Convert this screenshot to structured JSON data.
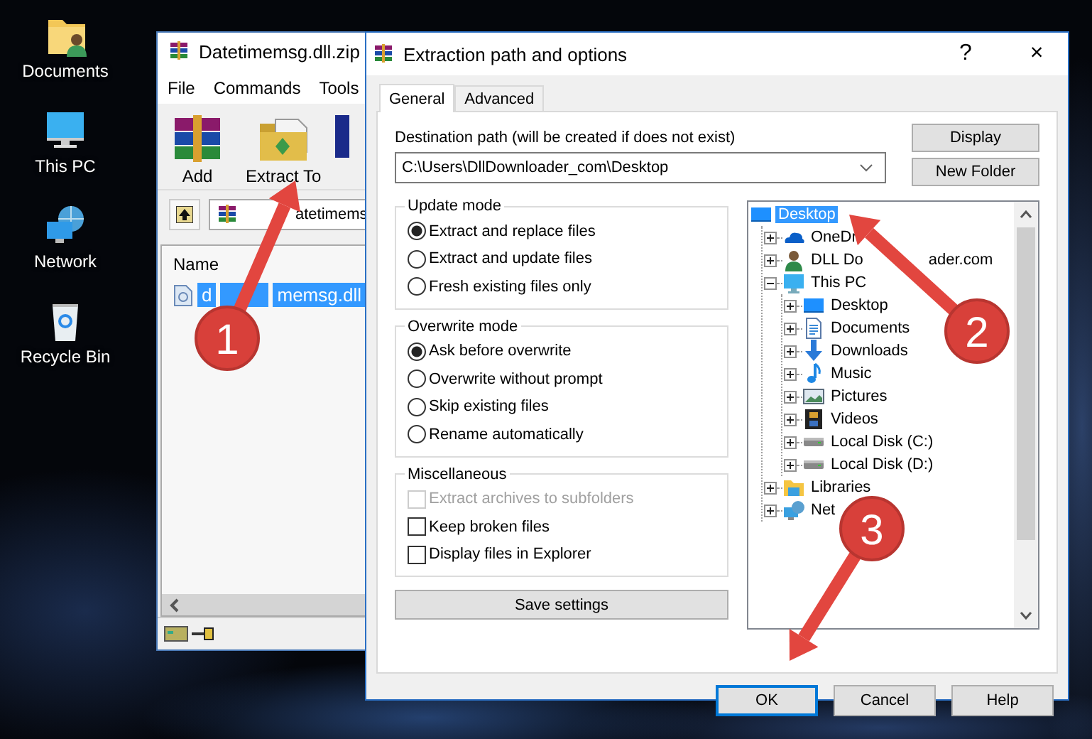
{
  "desktop_icons": [
    {
      "kind": "documents",
      "label": "Documents"
    },
    {
      "kind": "pc",
      "label": "This PC"
    },
    {
      "kind": "network",
      "label": "Network"
    },
    {
      "kind": "recycle",
      "label": "Recycle Bin"
    }
  ],
  "archiver": {
    "title": "Datetimemsg.dll.zip",
    "menu": [
      "File",
      "Commands",
      "Tools"
    ],
    "toolbar": [
      {
        "kind": "add",
        "label": "Add"
      },
      {
        "kind": "extract",
        "label": "Extract To"
      },
      {
        "kind": "book"
      }
    ],
    "path": "atetimems",
    "columns": [
      "Name"
    ],
    "files": [
      {
        "name": "d",
        "name_end": "memsg.dll",
        "selected": true
      }
    ]
  },
  "dialog": {
    "title": "Extraction path and options",
    "help": "?",
    "close": "×",
    "tabs": [
      {
        "label": "General",
        "selected": true
      },
      {
        "label": "Advanced",
        "selected": false
      }
    ],
    "destination": {
      "label": "Destination path (will be created if does not exist)",
      "value": "C:\\Users\\DllDownloader_com\\Desktop"
    },
    "side_buttons": [
      "Display",
      "New Folder"
    ],
    "groups": [
      {
        "title": "Update mode",
        "options": [
          {
            "kind": "radio",
            "label": "Extract and replace files",
            "selected": true
          },
          {
            "kind": "radio",
            "label": "Extract and update files",
            "selected": false
          },
          {
            "kind": "radio",
            "label": "Fresh existing files only",
            "selected": false
          }
        ]
      },
      {
        "title": "Overwrite mode",
        "options": [
          {
            "kind": "radio",
            "label": "Ask before overwrite",
            "selected": true
          },
          {
            "kind": "radio",
            "label": "Overwrite without prompt",
            "selected": false
          },
          {
            "kind": "radio",
            "label": "Skip existing files",
            "selected": false
          },
          {
            "kind": "radio",
            "label": "Rename automatically",
            "selected": false
          }
        ]
      },
      {
        "title": "Miscellaneous",
        "options": [
          {
            "kind": "checkbox",
            "label": "Extract archives to subfolders",
            "checked": false,
            "disabled": true
          },
          {
            "kind": "checkbox",
            "label": "Keep broken files",
            "checked": false,
            "disabled": false
          },
          {
            "kind": "checkbox",
            "label": "Display files in Explorer",
            "checked": false,
            "disabled": false
          }
        ]
      }
    ],
    "save_button": "Save settings",
    "tree": [
      {
        "kind": "desktop",
        "label": "Desktop",
        "selected": true,
        "children": [
          {
            "kind": "cloud",
            "label": "OneDr",
            "expanded": false,
            "selected": false
          },
          {
            "kind": "user",
            "label": "DLL Do",
            "label_end": "ader.com",
            "expanded": false,
            "selected": false
          },
          {
            "kind": "pc",
            "label": "This PC",
            "expanded": true,
            "selected": false,
            "children": [
              {
                "kind": "desktop",
                "label": "Desktop",
                "expanded": false,
                "selected": false
              },
              {
                "kind": "documents",
                "label": "Documents",
                "expanded": false,
                "selected": false
              },
              {
                "kind": "downloads",
                "label": "Downloads",
                "expanded": false,
                "selected": false
              },
              {
                "kind": "music",
                "label": "Music",
                "expanded": false,
                "selected": false
              },
              {
                "kind": "pictures",
                "label": "Pictures",
                "expanded": false,
                "selected": false
              },
              {
                "kind": "videos",
                "label": "Videos",
                "expanded": false,
                "selected": false
              },
              {
                "kind": "disk",
                "label": "Local Disk (C:)",
                "expanded": false,
                "selected": false
              },
              {
                "kind": "disk",
                "label": "Local Disk (D:)",
                "expanded": false,
                "selected": false
              }
            ]
          },
          {
            "kind": "library",
            "label": "Libraries",
            "expanded": false,
            "selected": false
          },
          {
            "kind": "network",
            "label": "Net",
            "expanded": false,
            "selected": false
          }
        ]
      }
    ],
    "buttons": [
      {
        "label": "OK",
        "default": true
      },
      {
        "label": "Cancel",
        "default": false
      },
      {
        "label": "Help",
        "default": false
      }
    ]
  },
  "annotations": [
    {
      "label": "1"
    },
    {
      "label": "2"
    },
    {
      "label": "3"
    }
  ]
}
